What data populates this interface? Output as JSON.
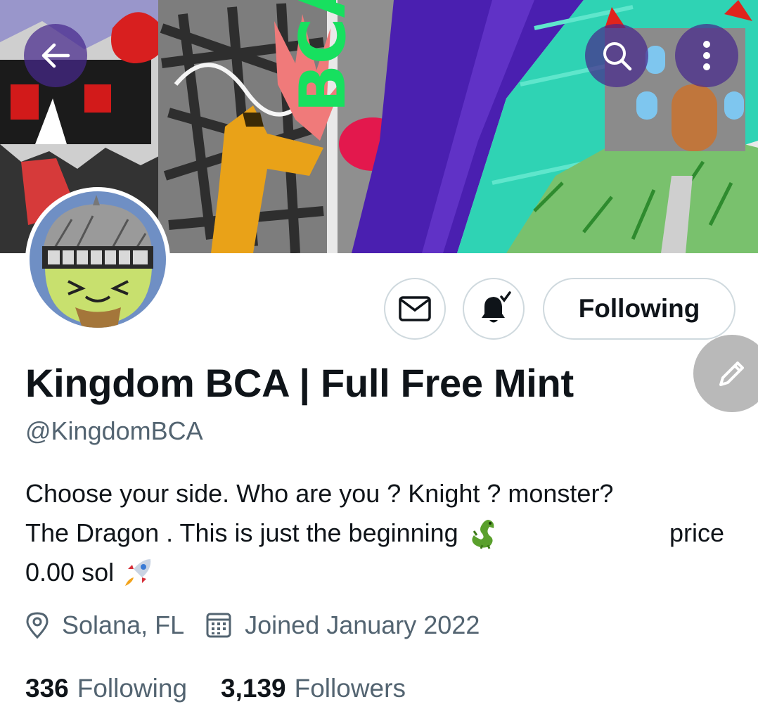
{
  "profile": {
    "display_name": "Kingdom BCA | Full Free Mint",
    "handle": "@KingdomBCA",
    "bio": {
      "line1": "Choose your side. Who are you ? Knight ? monster?",
      "line2": "The Dragon . This is just the beginning",
      "line2_emoji": "dragon-icon",
      "line2_tail": "price",
      "line3": "0.00 sol",
      "line3_emoji": "rocket-icon"
    },
    "location": "Solana, FL",
    "joined": "Joined January 2022",
    "stats": {
      "following_count": "336",
      "following_label": "Following",
      "followers_count": "3,139",
      "followers_label": "Followers"
    }
  },
  "banner": {
    "art_text": "BCA"
  },
  "actions": {
    "follow_button_label": "Following",
    "back_icon": "arrow-left-icon",
    "search_icon": "search-icon",
    "more_icon": "more-vertical-icon",
    "message_icon": "envelope-icon",
    "notify_icon": "bell-check-icon",
    "edit_icon": "pencil-icon"
  },
  "colors": {
    "text_primary": "#0f1419",
    "text_secondary": "#536471",
    "border": "#cfd9de",
    "overlay_button": "#46288c"
  }
}
